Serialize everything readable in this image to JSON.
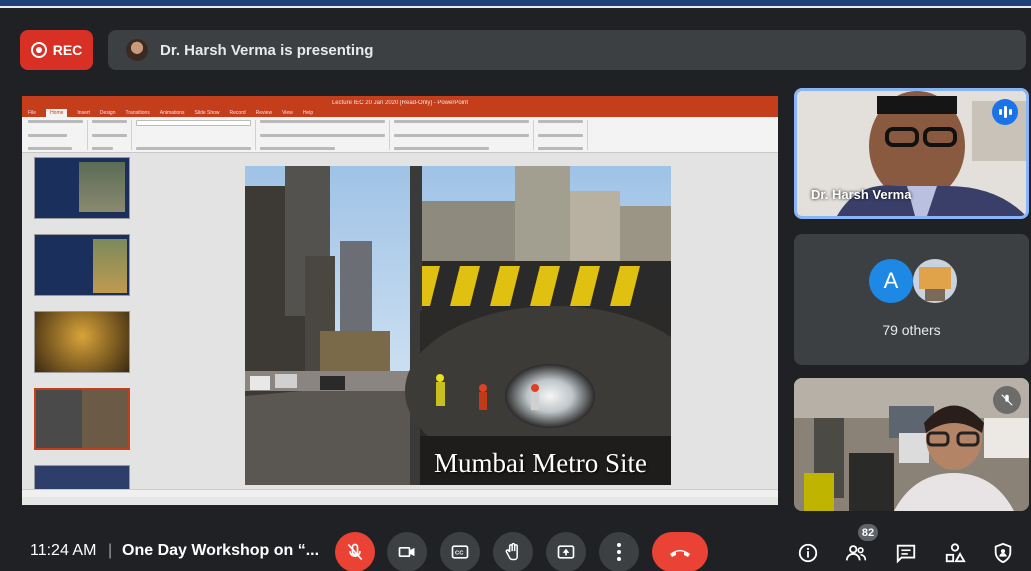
{
  "recording": {
    "label": "REC",
    "color": "#d93025"
  },
  "banner": {
    "text": "Dr. Harsh Verma is presenting"
  },
  "presentation": {
    "app_title": "Lecture IEC 20 Jan 2020 [Read-Only] - PowerPoint",
    "ribbon_tabs": [
      "File",
      "Home",
      "Insert",
      "Design",
      "Transitions",
      "Animations",
      "Slide Show",
      "Record",
      "Review",
      "View",
      "Help"
    ],
    "active_tab": "Home",
    "thumbnail_numbers": [
      "",
      "5",
      "6",
      "7",
      "8"
    ],
    "slide_caption": "Mumbai Metro Site"
  },
  "participants": {
    "presenter_name": "Dr. Harsh Verma",
    "avatar_initial": "A",
    "others_count_label": "79 others"
  },
  "bottom": {
    "time": "11:24 AM",
    "separator": "|",
    "meeting_name": "One Day Workshop on “...",
    "people_count": "82"
  },
  "icons": {
    "mic": "mic-off-icon",
    "camera": "camera-icon",
    "captions": "captions-icon",
    "hand": "raise-hand-icon",
    "present": "present-icon",
    "more": "more-vert-icon",
    "end": "end-call-icon",
    "info": "info-icon",
    "people": "people-icon",
    "chat": "chat-icon",
    "activities": "activities-icon",
    "host": "host-controls-icon"
  },
  "colors": {
    "end_call": "#ea4335",
    "speaking": "#1a73e8",
    "presenter_border": "#8ab4f8"
  }
}
